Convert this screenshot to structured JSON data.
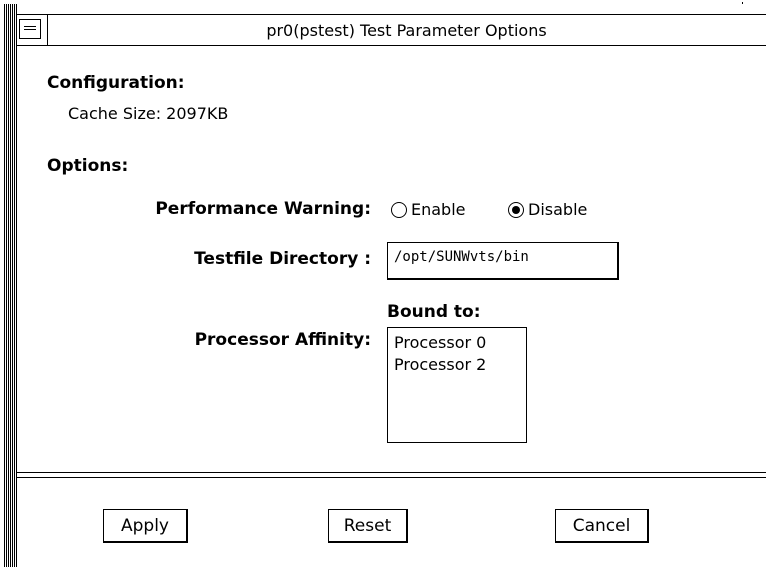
{
  "window": {
    "title": "pr0(pstest) Test Parameter Options"
  },
  "configuration": {
    "heading": "Configuration:",
    "cache_size": "Cache Size: 2097KB"
  },
  "options": {
    "heading": "Options:",
    "performance_warning": {
      "label": "Performance Warning:",
      "choices": [
        "Enable",
        "Disable"
      ],
      "selected": "Disable"
    },
    "testfile_directory": {
      "label": "Testfile Directory :",
      "value": "/opt/SUNWvts/bin"
    },
    "processor_affinity": {
      "label": "Processor Affinity:",
      "list_caption": "Bound to:",
      "items": [
        "Processor 0",
        "Processor 2"
      ]
    }
  },
  "buttons": {
    "apply": "Apply",
    "reset": "Reset",
    "cancel": "Cancel"
  }
}
